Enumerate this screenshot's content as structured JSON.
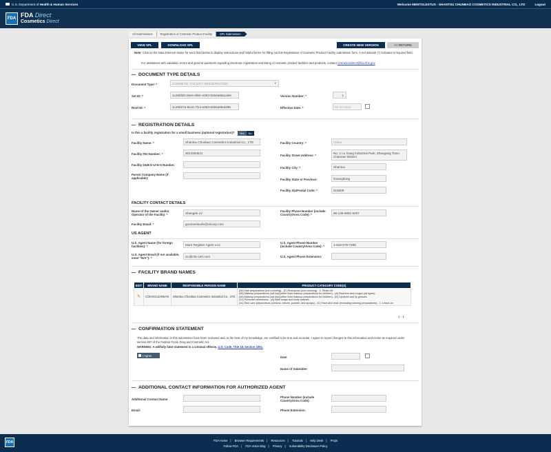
{
  "gov": {
    "dept_prefix": "U.S. Department of ",
    "dept_bold": "Health & Human Services",
    "welcome": "Welcome MENTOLESTUS - SHANTOU CHUNBAO COSMETICS INDUSTRIAL CO., LTD",
    "logout": "Logout"
  },
  "brand": {
    "logo": "FDA",
    "line1": "FDA",
    "line1b": "Direct",
    "line2": "Cosmetics",
    "line2b": "Direct"
  },
  "breadcrumbs": [
    "All Submissions",
    "Registration of Cosmetic Product Facility",
    "SPL Submission"
  ],
  "toolbar": {
    "view": "VIEW SPL",
    "download": "DOWNLOAD SPL",
    "create": "CREATE NEW VERSION",
    "return": "<< RETURN"
  },
  "note": {
    "label": "Note:",
    "text": " Click on the Data Element Name for each field below to display instructions and helpful forms for filling out this Registration of Cosmetic Product Facility submission form. A red asterisk (*) indicates a required field.",
    "assist": "For assistance with validation errors and general questions regarding electronic registration and listing of cosmetic product facilities and products, contact ",
    "email": "cosmeticsdirect@fda.hhs.gov"
  },
  "doc": {
    "title": "DOCUMENT TYPE DETAILS",
    "type_label": "Document Type:",
    "type_value": "COSMETIC FACILITY REGISTRATION",
    "setid_label": "Set ID:",
    "setid_value": "1c26bf30-28e6-d08c-e063-6294a90acde6",
    "version_label": "Version Number:",
    "version_value": "1",
    "rootid_label": "Root ID:",
    "rootid_value": "1c26b27a-9ec6-7f14-e063-6294a90af496",
    "date_label": "Effective Date:",
    "date_value": "08-30-2024"
  },
  "reg": {
    "title": "REGISTRATION DETAILS",
    "small_q": "Is this a facility registration for a small business (optional registration)?",
    "yes": "Yes",
    "no": "No",
    "name_label": "Facility Name:",
    "name_value": "Shantou Chunbao Cosmetics Industrial Co., LTD",
    "country_label": "Facility Country:",
    "country_value": "China",
    "fei_label": "Facility FEI Number:",
    "fei_value": "3014293621",
    "street_label": "Facility Street Address:",
    "street_value": "No. 1 Lu Gang Industrial Park, Zhaogang Town, Chaonan District",
    "duns_label": "Facility D&B D-U-N-S Number:",
    "parent_label": "Parent Company Name (if applicable):",
    "city_label": "Facility City:",
    "city_value": "Shantou",
    "state_label": "Facility State or Province:",
    "state_value": "Guangdong",
    "zip_label": "Facility Zip/Postal Code:",
    "zip_value": "515000"
  },
  "contact": {
    "title": "FACILITY CONTACT DETAILS",
    "owner_label": "Name of the Owner and/or Operator of the Facility:",
    "owner_value": "Shengde LV",
    "phone_label": "Facility Phone Number (include Country/Area Code):",
    "phone_value": "86-136-6891-9257",
    "email_label": "Facility Email:",
    "email_value": "goomentsorfe@clicorp.com"
  },
  "agent": {
    "title": "US AGENT",
    "name_label": "U.S. Agent Name (for foreign facilities):",
    "name_value": "Mars Register Agent LLC",
    "phone_label": "U.S. Agent Phone Number (include Country/Area Code):",
    "phone_value": "1-818-579-7288",
    "email_label": "U.S. Agent Email (if not available, enter \"N/A\"):",
    "email_value": "cic@clic-cert.com",
    "ext_label": "U.S. Agent Phone Extension:"
  },
  "brands": {
    "title": "FACILITY BRAND NAMES",
    "headers": [
      "EDIT",
      "BRAND NAME",
      "RESPONSIBLE PERSON NAME",
      "PRODUCT CATEGORY CODE(S)"
    ],
    "row": {
      "brand": "COKOGULHNIAN",
      "person": "Shantou Chunbao Cosmetics Industrial Co., LTD",
      "codes": [
        "(06) Hair preparations (non-coloring) - (F) Shampoos (non-coloring) - 2. Rinse-off",
        "(08) Makeup preparations (not eye)(other than makeup preparations for children) - (A) Blushers and rouges (all types)",
        "(08) Makeup preparations (not eye)(other than makeup preparations for children) - (E) Lipsticks and lip glosses",
        "(12) Personal cleanliness - (A) Bath soaps and body washes",
        "(14) Skin care preparations (creams, lotions, powder, and sprays) - (C) Face and neck (excluding shaving preparations) - 1. Leave-on"
      ]
    },
    "pager": "1 - 1"
  },
  "confirm": {
    "title": "CONFIRMATION STATEMENT",
    "text": "The data and information in this submission have been reviewed and, to the best of my knowledge, are certified to be true and accurate. I agree to report changes to this information and revise as required under section 607 of the Federal Food, Drug and Cosmetic Act.",
    "warn": "WARNING: A willfully false statement is a criminal offense, ",
    "warn_link": "U.S. Code, Title 18, Section 1001.",
    "agree": "I Agree",
    "date_label": "Date",
    "submitter_label": "Name of Submitter"
  },
  "additional": {
    "title": "ADDITIONAL CONTACT INFORMATION FOR AUTHORIZED AGENT",
    "name_label": "Additional Contact Name:",
    "phone_label": "Phone Number (include Country/Area Code):",
    "email_label": "Email:",
    "ext_label": "Phone Extension:"
  },
  "footer": {
    "logo": "FDA",
    "row1": [
      "FDA Home",
      "Browser Requirements",
      "Resources",
      "Tutorials",
      "Help Desk",
      "FAQs"
    ],
    "row2": [
      "Follow FDA",
      "FDA Voice Blog",
      "Privacy",
      "Vulnerability Disclosure Policy"
    ]
  }
}
